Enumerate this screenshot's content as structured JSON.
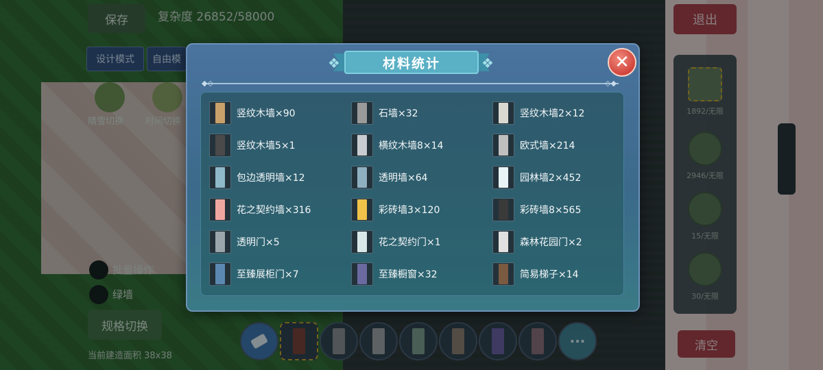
{
  "hud": {
    "save_label": "保存",
    "complexity_text": "复杂度 26852/58000",
    "design_mode_label": "设计模式",
    "free_mode_label": "自由模",
    "weather_label": "晴雪切换",
    "time_label": "时间切换",
    "batch_label": "批量操作",
    "wall_label": "绿墙",
    "spec_label": "规格切换",
    "area_text": "当前建造面积 38x38",
    "exit_label": "退出",
    "clear_label": "清空",
    "more_label": "···"
  },
  "side_panel": {
    "items": [
      {
        "count": "1892/无限",
        "icon": "wall-block-icon",
        "selected": true
      },
      {
        "count": "2946/无限",
        "icon": "brick-icon",
        "selected": false
      },
      {
        "count": "15/无限",
        "icon": "window-icon",
        "selected": false
      },
      {
        "count": "30/无限",
        "icon": "furniture-icon",
        "selected": false
      }
    ]
  },
  "bottom_bar": {
    "slots": [
      {
        "color": "#7a3a2c",
        "selected": true
      },
      {
        "color": "#8a8a8a",
        "selected": false
      },
      {
        "color": "#a0a0a0",
        "selected": false
      },
      {
        "color": "#7c9b88",
        "selected": false
      },
      {
        "color": "#8c7a6a",
        "selected": false
      },
      {
        "color": "#6b5a9e",
        "selected": false
      },
      {
        "color": "#8a6a72",
        "selected": false
      }
    ]
  },
  "dialog": {
    "title": "材料统计",
    "close_symbol": "✕",
    "materials": [
      {
        "label": "竖纹木墙×90",
        "color": "#c7a06a",
        "icon": "wood-wall-icon"
      },
      {
        "label": "石墙×32",
        "color": "#9a9a9a",
        "icon": "stone-wall-icon"
      },
      {
        "label": "竖纹木墙2×12",
        "color": "#d9d9d2",
        "icon": "wood-wall-icon"
      },
      {
        "label": "竖纹木墙5×1",
        "color": "#4a4a4a",
        "icon": "wood-wall-icon"
      },
      {
        "label": "横纹木墙8×14",
        "color": "#c9ccd0",
        "icon": "wood-wall-icon"
      },
      {
        "label": "欧式墙×214",
        "color": "#bfbfbf",
        "icon": "wall-icon"
      },
      {
        "label": "包边透明墙×12",
        "color": "#8fb8c8",
        "icon": "glass-wall-icon"
      },
      {
        "label": "透明墙×64",
        "color": "#8fb0c0",
        "icon": "glass-wall-icon"
      },
      {
        "label": "园林墙2×452",
        "color": "#e8f4f6",
        "icon": "wall-icon"
      },
      {
        "label": "花之契约墙×316",
        "color": "#f0a6a0",
        "icon": "flower-wall-icon"
      },
      {
        "label": "彩砖墙3×120",
        "color": "#f0c24a",
        "icon": "brick-wall-icon"
      },
      {
        "label": "彩砖墙8×565",
        "color": "#3a3a3a",
        "icon": "brick-wall-icon"
      },
      {
        "label": "透明门×5",
        "color": "#9aa6ab",
        "icon": "door-icon"
      },
      {
        "label": "花之契约门×1",
        "color": "#d8e8e8",
        "icon": "arch-door-icon"
      },
      {
        "label": "森林花园门×2",
        "color": "#e0e0e0",
        "icon": "arch-door-icon"
      },
      {
        "label": "至臻展柜门×7",
        "color": "#5a88b0",
        "icon": "cabinet-icon"
      },
      {
        "label": "至臻橱窗×32",
        "color": "#6a6aa0",
        "icon": "showcase-icon"
      },
      {
        "label": "简易梯子×14",
        "color": "#7a5a40",
        "icon": "ladder-icon"
      }
    ]
  }
}
